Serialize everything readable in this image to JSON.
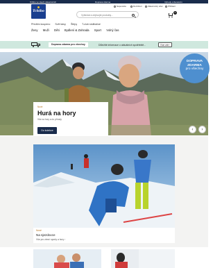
{
  "topbar": {
    "left": "Tchibo ve všech zákaznících",
    "center": "Doprava zdarma",
    "right": "Výhody s členstvím"
  },
  "header": {
    "logo_text": "Tchibo",
    "util": [
      {
        "label": "Nápověda",
        "icon": "help-icon"
      },
      {
        "label": "Rozšíření",
        "icon": "settings-icon"
      },
      {
        "label": "Zákaznický účet",
        "icon": "user-icon"
      },
      {
        "label": "Přihlásit",
        "icon": "login-icon"
      }
    ],
    "search_placeholder": "Vyhledat a objevujte produkty...",
    "cart_count": "0"
  },
  "nav_secondary": [
    "Předtím koupeno",
    "Svět kávy",
    "Štěpy",
    "T-club stoliháčsé"
  ],
  "nav_primary": [
    "Ženy",
    "Muži",
    "Děti",
    "Bydlení & Zahrada",
    "Sport",
    "Volný čas"
  ],
  "info_bar": {
    "label": "Doprava zdarma pro všechny",
    "text": "Důležité informace o aktuálních spotřebitě...",
    "button": "Více zde ›"
  },
  "hero": {
    "badge_line1": "DOPRAVA",
    "badge_line2": "ZDARMA",
    "badge_line3": "pro všechny",
    "tag": "Nové",
    "title": "Hurá na hory",
    "subtitle": "Vše na hory a do přírody",
    "button": "Do kolekce",
    "prev": "‹",
    "next": "›"
  },
  "tile": {
    "tag": "Nové",
    "title": "Na sjezdovce",
    "link": "Vše pro zimní sporty a hory ›"
  },
  "colors": {
    "brand_navy": "#1a2c4c",
    "info_mint": "#cfe8de",
    "promo_blue": "#4e8fcf",
    "tag_orange": "#b7731d"
  }
}
